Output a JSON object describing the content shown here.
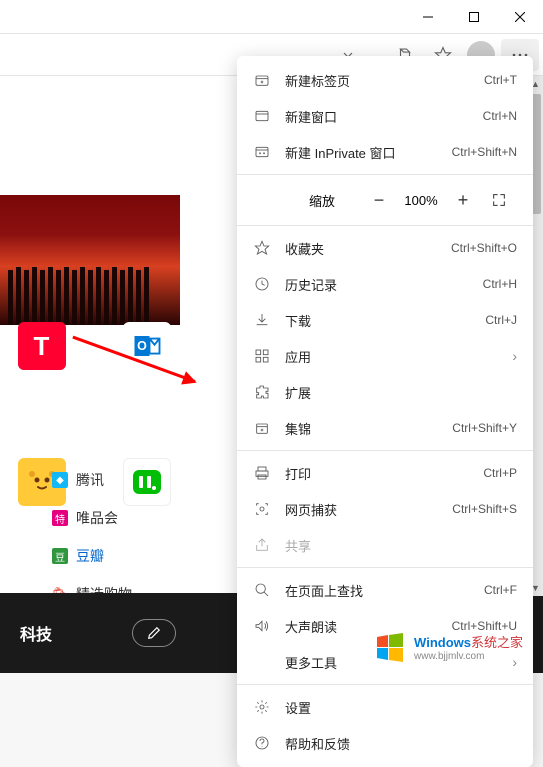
{
  "titlebar": {
    "minimize": "minimize",
    "maximize": "maximize",
    "close": "close"
  },
  "menu": {
    "new_tab": {
      "label": "新建标签页",
      "shortcut": "Ctrl+T"
    },
    "new_window": {
      "label": "新建窗口",
      "shortcut": "Ctrl+N"
    },
    "new_inprivate": {
      "label": "新建 InPrivate 窗口",
      "shortcut": "Ctrl+Shift+N"
    },
    "zoom": {
      "label": "缩放",
      "value": "100%"
    },
    "favorites": {
      "label": "收藏夹",
      "shortcut": "Ctrl+Shift+O"
    },
    "history": {
      "label": "历史记录",
      "shortcut": "Ctrl+H"
    },
    "downloads": {
      "label": "下载",
      "shortcut": "Ctrl+J"
    },
    "apps": {
      "label": "应用"
    },
    "extensions": {
      "label": "扩展"
    },
    "collections": {
      "label": "集锦",
      "shortcut": "Ctrl+Shift+Y"
    },
    "print": {
      "label": "打印",
      "shortcut": "Ctrl+P"
    },
    "capture": {
      "label": "网页捕获",
      "shortcut": "Ctrl+Shift+S"
    },
    "share": {
      "label": "共享"
    },
    "find": {
      "label": "在页面上查找",
      "shortcut": "Ctrl+F"
    },
    "read_aloud": {
      "label": "大声朗读",
      "shortcut": "Ctrl+Shift+U"
    },
    "more_tools": {
      "label": "更多工具"
    },
    "settings": {
      "label": "设置"
    },
    "help": {
      "label": "帮助和反馈"
    }
  },
  "tiles": {
    "tmall": {
      "label": "天猫",
      "glyph": "T",
      "bg": "#ff0030"
    },
    "outlook": {
      "label": "Outlook邮箱",
      "bg": "#ffffff"
    },
    "lion": {
      "bg": "#ffc938"
    },
    "iqiyi": {
      "bg": "#00be06"
    }
  },
  "links": {
    "tencent": "腾讯",
    "vip": "唯品会",
    "douban": "豆瓣",
    "shopping": "精选购物"
  },
  "bottom": {
    "tech": "科技"
  },
  "watermark": {
    "brand_blue": "Windows",
    "brand_red": "系统之家",
    "url": "www.bjjmlv.com"
  }
}
